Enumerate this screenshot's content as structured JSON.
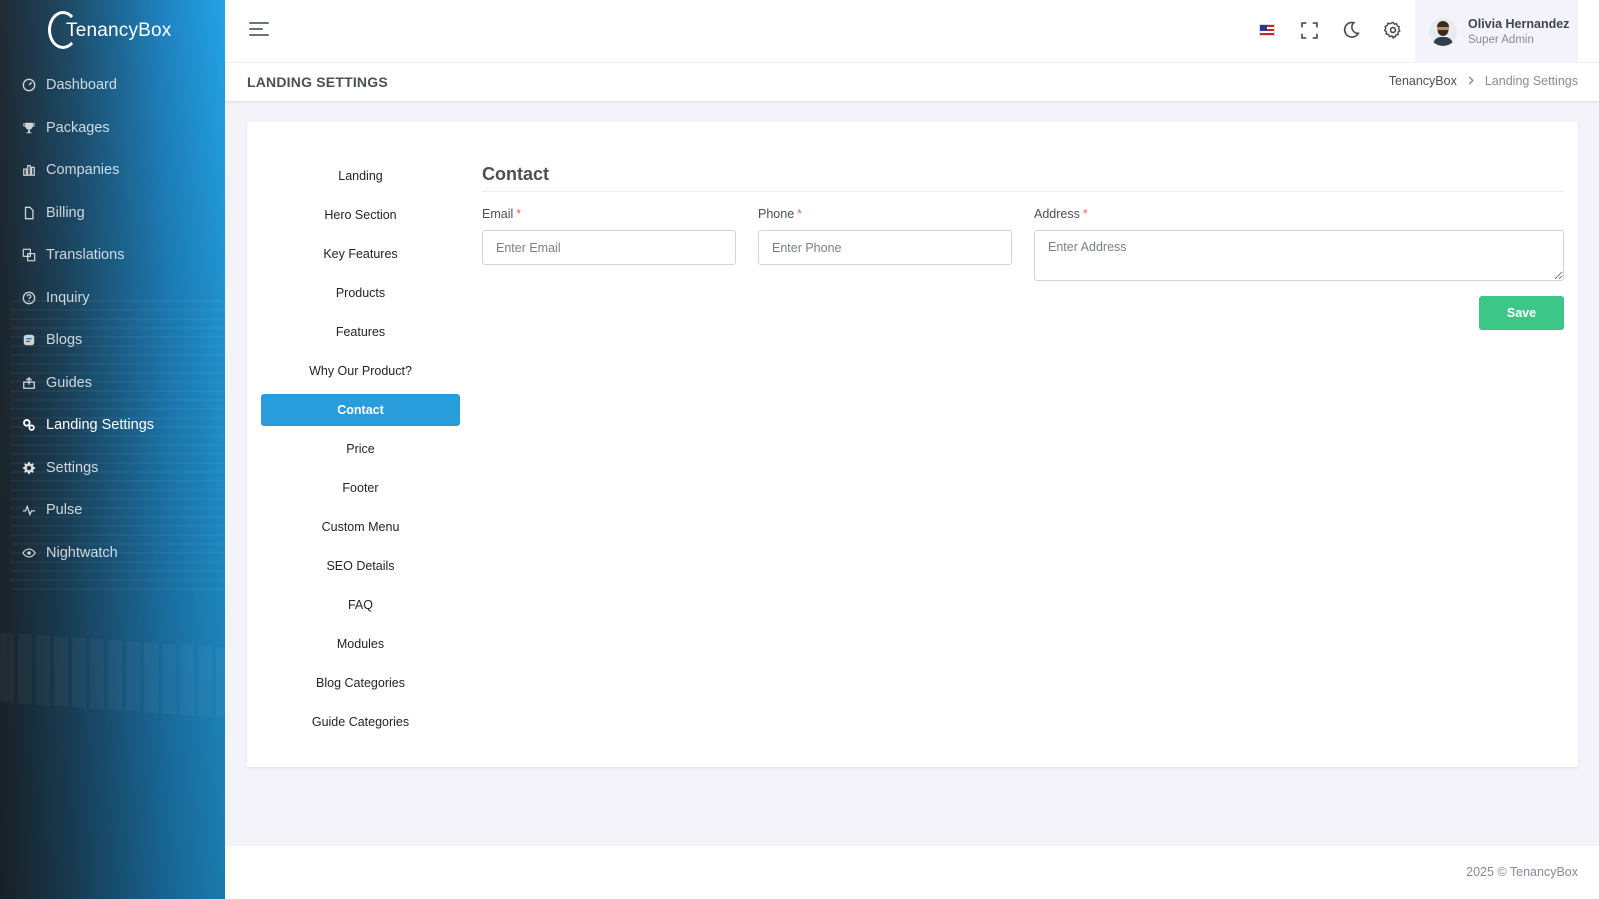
{
  "brand": {
    "name": "TenancyBox"
  },
  "sidebar": {
    "items": [
      {
        "label": "Dashboard",
        "icon": "dashboard-icon"
      },
      {
        "label": "Packages",
        "icon": "trophy-icon"
      },
      {
        "label": "Companies",
        "icon": "bar-chart-icon"
      },
      {
        "label": "Billing",
        "icon": "file-icon"
      },
      {
        "label": "Translations",
        "icon": "translate-icon"
      },
      {
        "label": "Inquiry",
        "icon": "question-icon"
      },
      {
        "label": "Blogs",
        "icon": "blog-icon"
      },
      {
        "label": "Guides",
        "icon": "guide-icon"
      },
      {
        "label": "Landing Settings",
        "icon": "cogs-icon",
        "active": true
      },
      {
        "label": "Settings",
        "icon": "gear-icon"
      },
      {
        "label": "Pulse",
        "icon": "pulse-icon"
      },
      {
        "label": "Nightwatch",
        "icon": "eye-icon"
      }
    ]
  },
  "topbar": {
    "icons": [
      "us-flag-icon",
      "fullscreen-icon",
      "moon-icon",
      "settings-icon"
    ],
    "user": {
      "name": "Olivia Hernandez",
      "role": "Super Admin"
    }
  },
  "page": {
    "title": "LANDING SETTINGS",
    "breadcrumb": {
      "root": "TenancyBox",
      "current": "Landing Settings"
    }
  },
  "tabs": [
    "Landing",
    "Hero Section",
    "Key Features",
    "Products",
    "Features",
    "Why Our Product?",
    "Contact",
    "Price",
    "Footer",
    "Custom Menu",
    "SEO Details",
    "FAQ",
    "Modules",
    "Blog Categories",
    "Guide Categories"
  ],
  "active_tab": "Contact",
  "form": {
    "title": "Contact",
    "email": {
      "label": "Email",
      "placeholder": "Enter Email",
      "value": ""
    },
    "phone": {
      "label": "Phone",
      "placeholder": "Enter Phone",
      "value": ""
    },
    "address": {
      "label": "Address",
      "placeholder": "Enter Address",
      "value": ""
    },
    "required_mark": "*",
    "save_label": "Save"
  },
  "footer": {
    "text": "2025 © TenancyBox"
  },
  "colors": {
    "primary": "#299cdb",
    "success": "#3cc687",
    "danger": "#f06548"
  }
}
